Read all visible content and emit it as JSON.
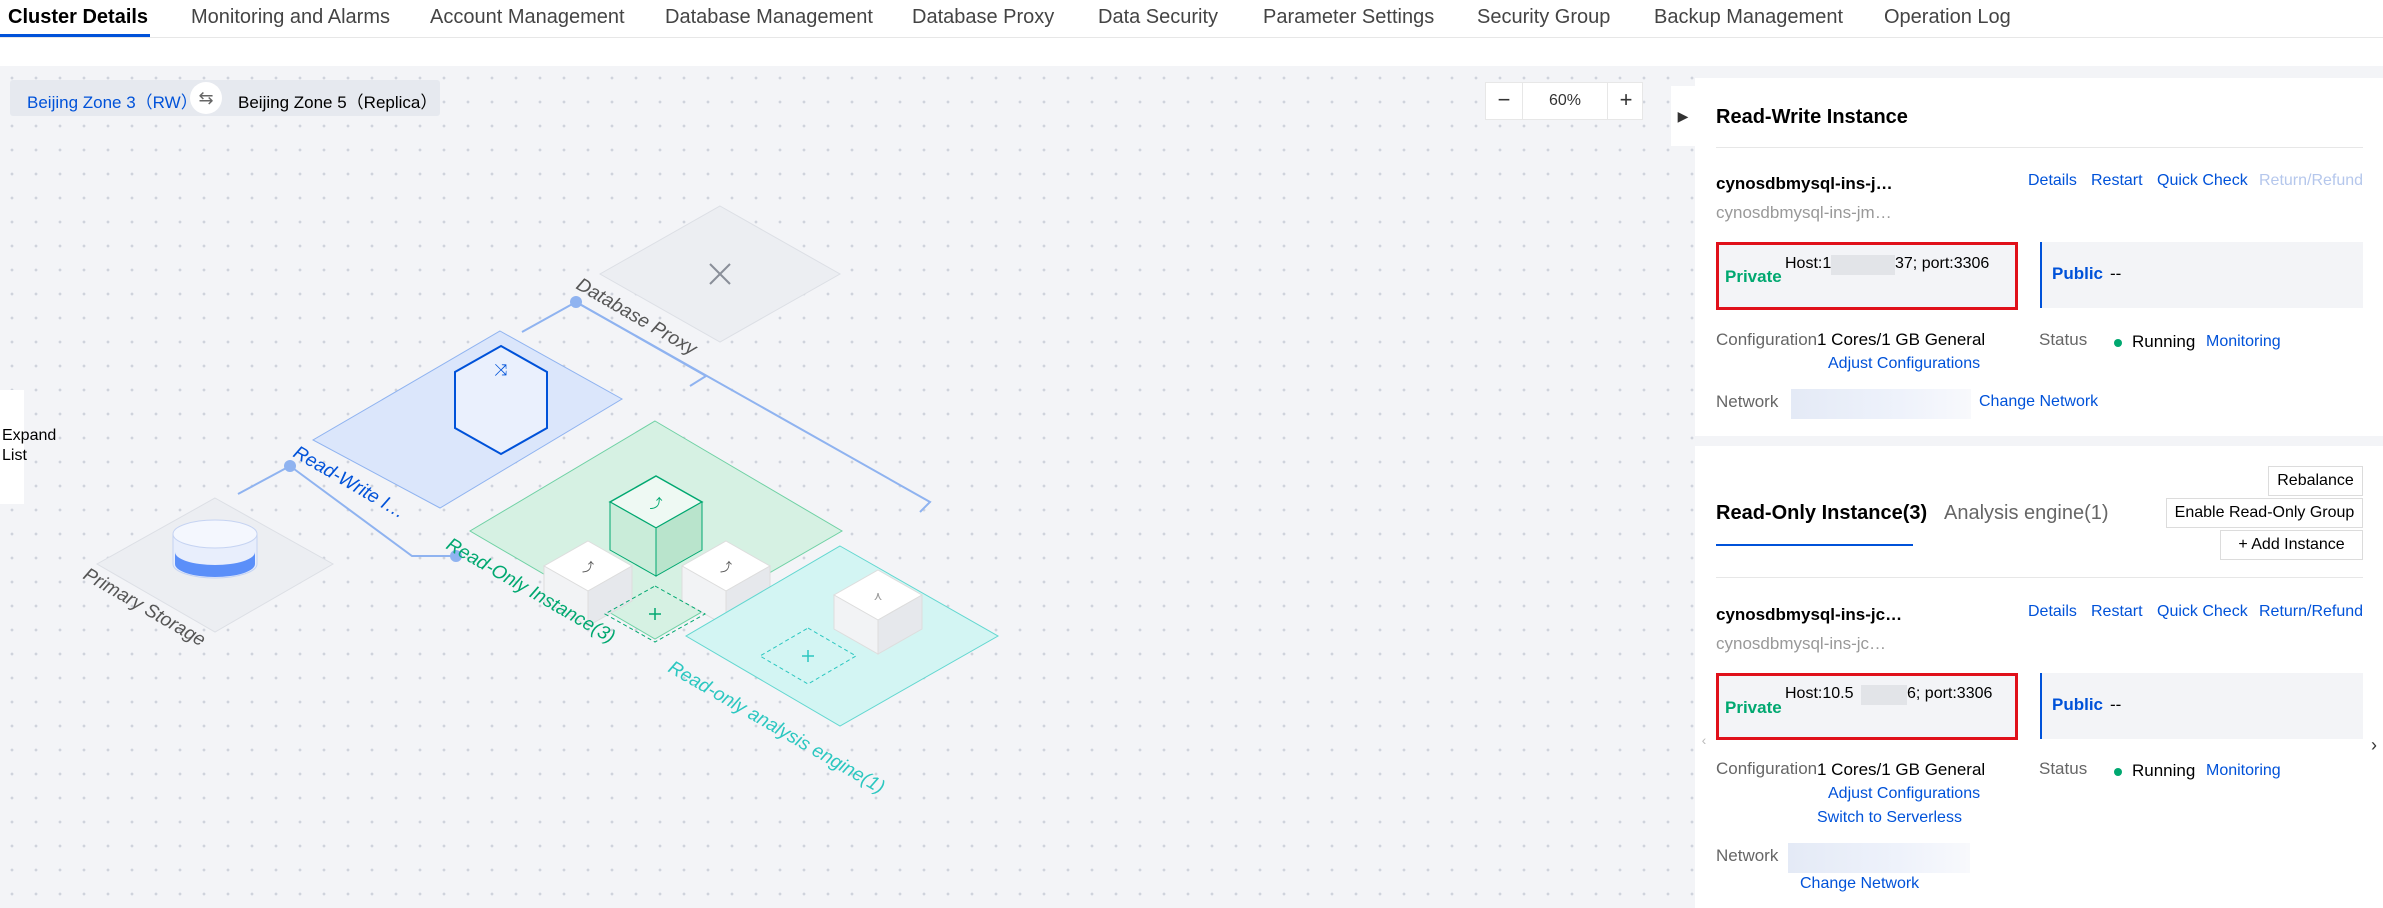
{
  "tabs": {
    "cluster_details": "Cluster Details",
    "monitoring_and_alarms": "Monitoring and Alarms",
    "account_management": "Account Management",
    "database_management": "Database Management",
    "database_proxy": "Database Proxy",
    "data_security": "Data Security",
    "parameter_settings": "Parameter Settings",
    "security_group": "Security Group",
    "backup_management": "Backup Management",
    "operation_log": "Operation Log"
  },
  "zone": {
    "primary": "Beijing Zone 3（RW）",
    "replica": "Beijing Zone 5（Replica）",
    "swap_icon": "⇆"
  },
  "zoom": {
    "minus": "−",
    "level": "60%",
    "plus": "+"
  },
  "expand_list": "Expand List",
  "topology": {
    "database_proxy": "Database Proxy",
    "read_write": "Read-Write I…",
    "read_only": "Read-Only Instance(3)",
    "primary_storage": "Primary Storage",
    "analysis_engine": "Read-only analysis engine(1)"
  },
  "rw_panel": {
    "title": "Read-Write Instance",
    "instance_name": "cynosdbmysql-ins-j…",
    "instance_id": "cynosdbmysql-ins-jm…",
    "actions": {
      "details": "Details",
      "restart": "Restart",
      "quick_check": "Quick Check",
      "return_refund": "Return/Refund"
    },
    "private_label": "Private",
    "host_prefix": "Host:1",
    "host_suffix": "37; port:3306",
    "public_label": "Public",
    "public_value": "--",
    "configuration_label": "Configuration",
    "configuration_value": "1 Cores/1 GB General",
    "adjust_configurations": "Adjust Configurations",
    "status_label": "Status",
    "status_value": "Running",
    "monitoring": "Monitoring",
    "network_label": "Network",
    "change_network": "Change Network"
  },
  "ro_panel": {
    "rebalance": "Rebalance",
    "enable_ro_group": "Enable Read-Only Group",
    "add_instance": "+ Add Instance",
    "tab_read_only": "Read-Only Instance(3)",
    "tab_analysis": "Analysis engine(1)",
    "instance_name": "cynosdbmysql-ins-jc…",
    "instance_id": "cynosdbmysql-ins-jc…",
    "actions": {
      "details": "Details",
      "restart": "Restart",
      "quick_check": "Quick Check",
      "return_refund": "Return/Refund"
    },
    "private_label": "Private",
    "host_prefix": "Host:10.5",
    "host_suffix": "6; port:3306",
    "public_label": "Public",
    "public_value": "--",
    "configuration_label": "Configuration",
    "configuration_value": "1 Cores/1 GB General",
    "adjust_configurations": "Adjust Configurations",
    "switch_serverless": "Switch to Serverless",
    "status_label": "Status",
    "status_value": "Running",
    "monitoring": "Monitoring",
    "network_label": "Network",
    "change_network": "Change Network"
  },
  "colors": {
    "accent": "#0052d9",
    "success": "#00a870",
    "highlight_border": "#e0101a",
    "rw_area": "#dbe6fb",
    "ro_area": "#d6f1e3",
    "analysis_area": "#d3f5f3"
  }
}
